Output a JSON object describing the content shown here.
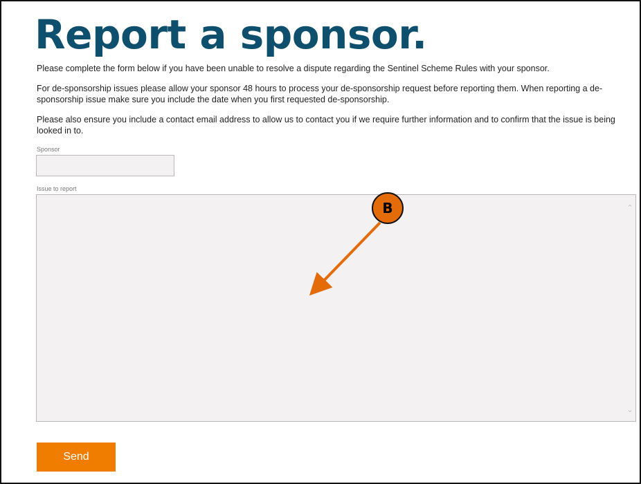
{
  "page": {
    "title": "Report a sponsor.",
    "paragraphs": [
      "Please complete the form below if you have been unable to resolve a dispute regarding the Sentinel Scheme Rules with your sponsor.",
      "For de-sponsorship issues please allow your sponsor 48 hours to process your de-sponsorship request before reporting them. When reporting a de-sponsorship issue make sure you include the date when you first requested de-sponsorship.",
      "Please also ensure you include a contact email address to allow us to contact you if we require further information and to confirm that the issue is being looked in to."
    ]
  },
  "form": {
    "sponsor_label": "Sponsor",
    "sponsor_value": "",
    "issue_label": "Issue to report",
    "issue_value": "",
    "send_label": "Send"
  },
  "annotation": {
    "badge_label": "B",
    "colors": {
      "badge": "#e36c09",
      "arrow": "#e36c09"
    }
  },
  "colors": {
    "title": "#0d4f6c",
    "button": "#f07d00",
    "field_bg": "#f3f1f1"
  },
  "icons": {
    "scroll_up": "chevron-up-icon",
    "scroll_down": "chevron-down-icon"
  }
}
